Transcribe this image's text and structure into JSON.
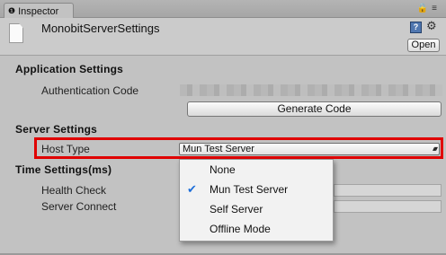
{
  "tab": {
    "icon": "info-icon",
    "label": "Inspector",
    "tools": [
      "lock-icon",
      "menu-icon"
    ]
  },
  "header": {
    "title": "MonobitServerSettings",
    "help_icon": "help-icon",
    "settings_icon": "gear-icon",
    "open_label": "Open"
  },
  "application_settings": {
    "title": "Application Settings",
    "auth_code_label": "Authentication Code",
    "generate_button": "Generate Code"
  },
  "server_settings": {
    "title": "Server Settings",
    "host_type_label": "Host Type",
    "host_type_value": "Mun Test Server"
  },
  "time_settings": {
    "title": "Time Settings(ms)",
    "health_check_label": "Health Check",
    "server_connect_label": "Server Connect"
  },
  "dropdown": {
    "options": [
      {
        "label": "None",
        "selected": false
      },
      {
        "label": "Mun Test Server",
        "selected": true
      },
      {
        "label": "Self Server",
        "selected": false
      },
      {
        "label": "Offline Mode",
        "selected": false
      }
    ],
    "check_glyph": "✔"
  },
  "colors": {
    "highlight": "#e00000",
    "check": "#1e6fd9",
    "background": "#c2c2c2"
  }
}
